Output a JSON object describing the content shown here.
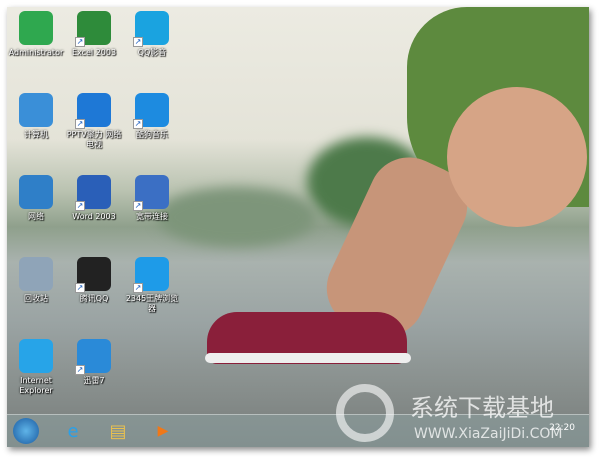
{
  "desktop": {
    "icons": [
      {
        "label": "Administrator",
        "icon": "user-icon",
        "color": "#2fa84f"
      },
      {
        "label": "Excel 2003",
        "icon": "excel-icon",
        "color": "#2e8b3a"
      },
      {
        "label": "QQ影音",
        "icon": "qq-player-icon",
        "color": "#1aa3e0"
      },
      {
        "label": "计算机",
        "icon": "computer-icon",
        "color": "#3a8fd8"
      },
      {
        "label": "PPTV聚力 网络电视",
        "icon": "pptv-icon",
        "color": "#1e78d6"
      },
      {
        "label": "酷狗音乐",
        "icon": "kugou-icon",
        "color": "#1d8be0"
      },
      {
        "label": "网络",
        "icon": "network-globe-icon",
        "color": "#2f7fc8"
      },
      {
        "label": "Word 2003",
        "icon": "word-icon",
        "color": "#2a5fb8"
      },
      {
        "label": "宽带连接",
        "icon": "broadband-icon",
        "color": "#3b6fc4"
      },
      {
        "label": "回收站",
        "icon": "recycle-bin-icon",
        "color": "#8fa4b8"
      },
      {
        "label": "腾讯QQ",
        "icon": "qq-penguin-icon",
        "color": "#222"
      },
      {
        "label": "2345王牌浏览器",
        "icon": "browser-2345-icon",
        "color": "#1e9be8"
      },
      {
        "label": "Internet Explorer",
        "icon": "ie-icon",
        "color": "#27a4e8"
      },
      {
        "label": "迅雷7",
        "icon": "xunlei-bird-icon",
        "color": "#2a8ad8"
      }
    ]
  },
  "taskbar": {
    "start": "start-orb-icon",
    "pinned": [
      {
        "icon": "ie-icon",
        "glyph": "e"
      },
      {
        "icon": "explorer-folder-icon",
        "glyph": "▤"
      },
      {
        "icon": "media-player-icon",
        "glyph": "▶"
      }
    ],
    "clock": "22:20"
  },
  "watermark": {
    "title": "系统下载基地",
    "url": "WWW.XiaZaiJiDi.COM"
  }
}
